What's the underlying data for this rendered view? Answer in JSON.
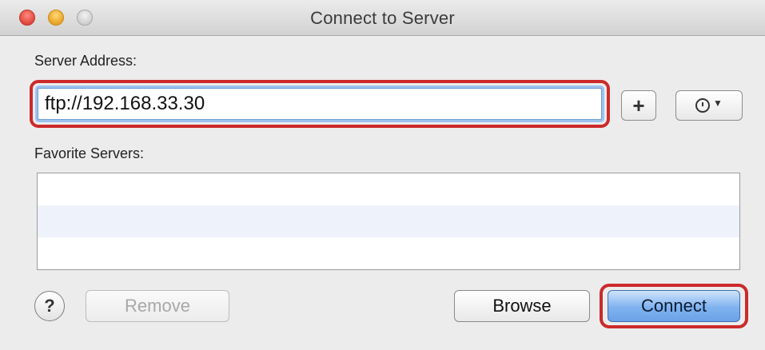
{
  "window": {
    "title": "Connect to Server"
  },
  "form": {
    "server_address_label": "Server Address:",
    "server_address_value": "ftp://192.168.33.30",
    "favorites_label": "Favorite Servers:",
    "favorite_servers": []
  },
  "buttons": {
    "add_label": "+",
    "recent_icon": "clock-icon",
    "help_label": "?",
    "remove_label": "Remove",
    "browse_label": "Browse",
    "connect_label": "Connect"
  },
  "colors": {
    "highlight": "#cc2a2a",
    "focus_ring": "#9cc3f0",
    "default_button": "#7fb2ef"
  }
}
